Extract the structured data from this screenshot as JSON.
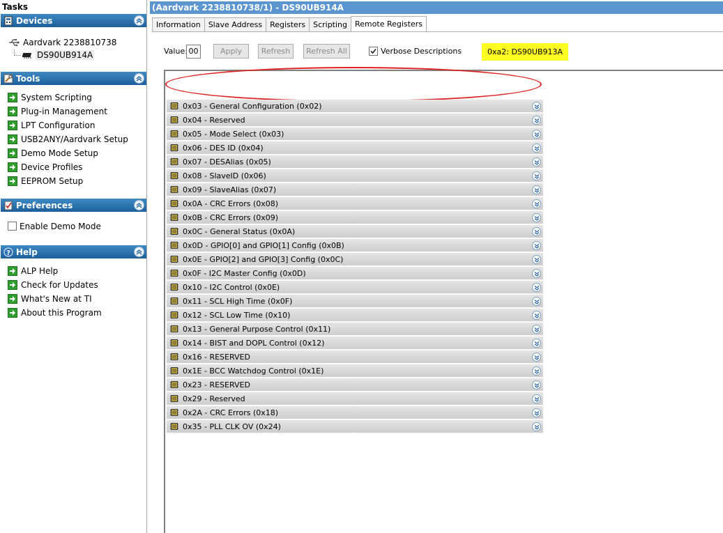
{
  "tasks_pane": {
    "title": "Tasks",
    "devices": {
      "header": "Devices",
      "adapter": "Aardvark 2238810738",
      "device": "DS90UB914A"
    },
    "tools": {
      "header": "Tools",
      "items": [
        {
          "label": "System Scripting"
        },
        {
          "label": "Plug-in Management"
        },
        {
          "label": "LPT Configuration"
        },
        {
          "label": "USB2ANY/Aardvark Setup"
        },
        {
          "label": "Demo Mode Setup"
        },
        {
          "label": "Device Profiles"
        },
        {
          "label": "EEPROM Setup"
        }
      ]
    },
    "preferences": {
      "header": "Preferences",
      "demo_mode_label": "Enable Demo Mode"
    },
    "help": {
      "header": "Help",
      "items": [
        {
          "label": "ALP Help"
        },
        {
          "label": "Check for Updates"
        },
        {
          "label": "What's New at TI"
        },
        {
          "label": "About this Program"
        }
      ]
    }
  },
  "main": {
    "title": "(Aardvark 2238810738/1) - DS90UB914A",
    "tabs": [
      {
        "label": "Information"
      },
      {
        "label": "Slave Address"
      },
      {
        "label": "Registers"
      },
      {
        "label": "Scripting"
      },
      {
        "label": "Remote Registers",
        "active": true
      }
    ],
    "toolbar": {
      "value_label": "Value:",
      "value": "00",
      "apply": "Apply",
      "refresh": "Refresh",
      "refresh_all": "Refresh All",
      "verbose_label": "Verbose Descriptions",
      "verbose_checked": true,
      "remote_device": "0xa2: DS90UB913A",
      "remote_highlight_color": "#ffff22"
    },
    "annotation_color": "#e02020",
    "registers": [
      {
        "label": "0x03 - General Configuration (0x02)"
      },
      {
        "label": "0x04 - Reserved"
      },
      {
        "label": "0x05 - Mode Select (0x03)"
      },
      {
        "label": "0x06 - DES ID (0x04)"
      },
      {
        "label": "0x07 - DESAlias (0x05)"
      },
      {
        "label": "0x08 - SlaveID (0x06)"
      },
      {
        "label": "0x09 - SlaveAlias (0x07)"
      },
      {
        "label": "0x0A - CRC Errors (0x08)"
      },
      {
        "label": "0x0B - CRC Errors (0x09)"
      },
      {
        "label": "0x0C - General Status (0x0A)"
      },
      {
        "label": "0x0D - GPIO[0] and GPIO[1] Config (0x0B)"
      },
      {
        "label": "0x0E - GPIO[2] and GPIO[3] Config (0x0C)"
      },
      {
        "label": "0x0F - I2C Master Config (0x0D)"
      },
      {
        "label": "0x10 - I2C Control (0x0E)"
      },
      {
        "label": "0x11 - SCL High Time (0x0F)"
      },
      {
        "label": "0x12 - SCL Low Time (0x10)"
      },
      {
        "label": "0x13 - General Purpose Control (0x11)"
      },
      {
        "label": "0x14 - BIST and DOPL Control (0x12)"
      },
      {
        "label": "0x16 - RESERVED"
      },
      {
        "label": "0x1E - BCC Watchdog Control (0x1E)"
      },
      {
        "label": "0x23 - RESERVED"
      },
      {
        "label": "0x29 - Reserved"
      },
      {
        "label": "0x2A - CRC Errors (0x18)"
      },
      {
        "label": "0x35 - PLL CLK OV (0x24)"
      }
    ]
  }
}
